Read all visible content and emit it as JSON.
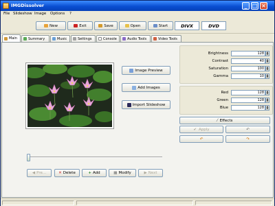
{
  "window": {
    "title": "IMGDissolver"
  },
  "menu": [
    "File",
    "Slideshow",
    "Image",
    "Options",
    "?"
  ],
  "toolbar": {
    "buttons": [
      {
        "label": "New",
        "icon": "new-document-icon",
        "color": "#e8a33a"
      },
      {
        "label": "Exit",
        "icon": "exit-icon",
        "color": "#cc2222"
      },
      {
        "label": "Save",
        "icon": "save-disk-icon",
        "color": "#d39a2c"
      },
      {
        "label": "Open",
        "icon": "open-folder-icon",
        "color": "#e6c14a"
      },
      {
        "label": "Start",
        "icon": "start-icon",
        "color": "#6b8ec8"
      }
    ],
    "brands": [
      "DIVX",
      "DVD"
    ]
  },
  "tabs": [
    {
      "label": "Main",
      "active": true
    },
    {
      "label": "Summary"
    },
    {
      "label": "Music"
    },
    {
      "label": "Settings"
    },
    {
      "label": "Console"
    },
    {
      "label": "Audio Tools"
    },
    {
      "label": "Video Tools"
    }
  ],
  "actions": {
    "image_preview": "Image Preview",
    "add_images": "Add Images",
    "import_slideshow": "Import Slideshow"
  },
  "adjustments": [
    {
      "label": "Brightness",
      "value": "128"
    },
    {
      "label": "Contrast",
      "value": "40"
    },
    {
      "label": "Saturation",
      "value": "100"
    },
    {
      "label": "Gamma",
      "value": "10"
    }
  ],
  "colors": [
    {
      "label": "Red",
      "value": "128"
    },
    {
      "label": "Green",
      "value": "128"
    },
    {
      "label": "Blue",
      "value": "128"
    }
  ],
  "effects": {
    "effects_label": "Effects",
    "apply_label": "Apply"
  },
  "navigation": {
    "prev": "Pre...",
    "delete": "Delete",
    "add": "Add",
    "modify": "Modify",
    "next": "Next"
  }
}
